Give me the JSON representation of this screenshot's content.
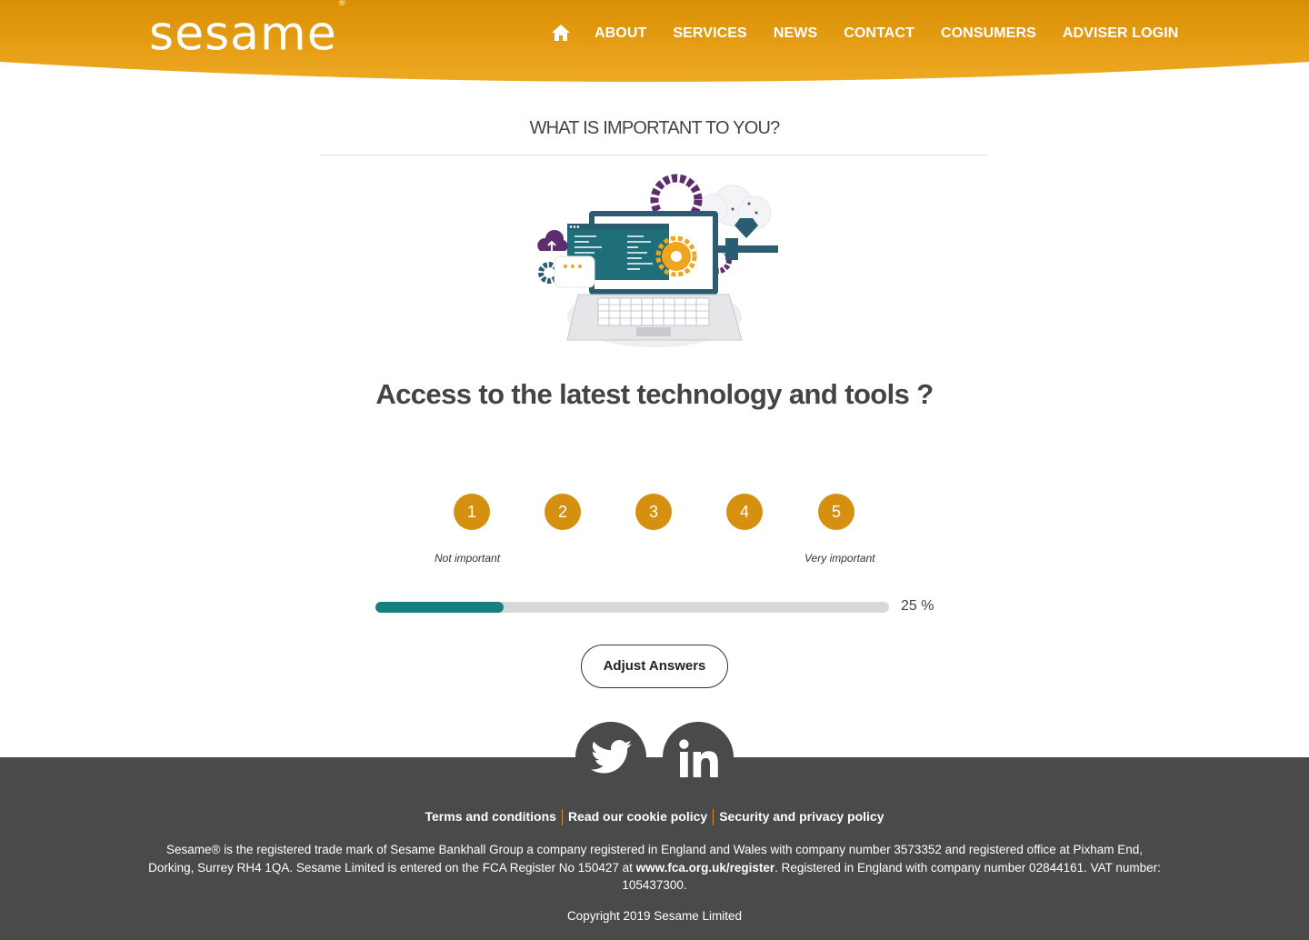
{
  "header": {
    "logo_text": "sesame",
    "logo_mark": "®",
    "brand_color": "#E8A31A",
    "nav": {
      "home_icon": "home-icon",
      "items": [
        "ABOUT",
        "SERVICES",
        "NEWS",
        "CONTACT",
        "CONSUMERS",
        "ADVISER LOGIN"
      ]
    }
  },
  "main": {
    "section_title": "WHAT IS IMPORTANT TO YOU?",
    "question": "Access to the latest technology and tools ?",
    "rating": {
      "options": [
        "1",
        "2",
        "3",
        "4",
        "5"
      ],
      "low_label": "Not important",
      "high_label": "Very important",
      "button_color": "#D4900E"
    },
    "progress": {
      "value": 0.25,
      "label": "25 %",
      "fill_color": "#167F7F"
    },
    "adjust_button": "Adjust Answers"
  },
  "social": {
    "twitter_icon": "twitter-icon",
    "linkedin_icon": "linkedin-icon"
  },
  "footer": {
    "links": [
      "Terms and conditions",
      "Read our cookie policy",
      "Security and privacy policy"
    ],
    "legal_part1": "Sesame® is the registered trade mark of Sesame Bankhall Group a company registered in England and Wales with company number 3573352 and registered office at Pixham End, Dorking, Surrey RH4 1QA. Sesame Limited is entered on the FCA Register No 150427 at ",
    "legal_link": "www.fca.org.uk/register",
    "legal_part2": ". Registered in England with company number 02844161. VAT number: 105437300.",
    "copyright": "Copyright 2019 Sesame Limited"
  }
}
